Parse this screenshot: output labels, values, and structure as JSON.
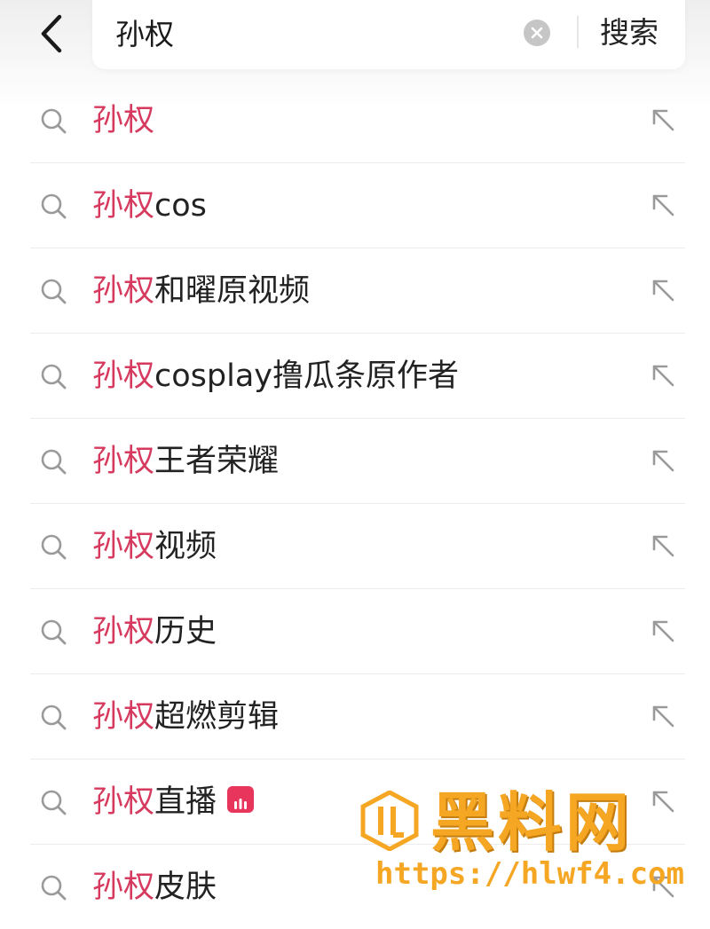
{
  "header": {
    "back_icon": "chevron-left-icon",
    "query": "孙权",
    "clear_icon": "clear-circle-icon",
    "search_label": "搜索"
  },
  "suggestions": [
    {
      "highlight": "孙权",
      "rest": "",
      "badge": null
    },
    {
      "highlight": "孙权",
      "rest": "cos",
      "badge": null
    },
    {
      "highlight": "孙权",
      "rest": "和曜原视频",
      "badge": null
    },
    {
      "highlight": "孙权",
      "rest": "cosplay撸瓜条原作者",
      "badge": null
    },
    {
      "highlight": "孙权",
      "rest": "王者荣耀",
      "badge": null
    },
    {
      "highlight": "孙权",
      "rest": "视频",
      "badge": null
    },
    {
      "highlight": "孙权",
      "rest": "历史",
      "badge": null
    },
    {
      "highlight": "孙权",
      "rest": "超燃剪辑",
      "badge": null
    },
    {
      "highlight": "孙权",
      "rest": "直播",
      "badge": "live-icon"
    },
    {
      "highlight": "孙权",
      "rest": "皮肤",
      "badge": null
    }
  ],
  "colors": {
    "highlight": "#d63a5e",
    "live_badge": "#e8355b",
    "watermark": "#f5a623"
  },
  "watermark": {
    "title": "黑料网",
    "url": "https://hlwf4.com"
  }
}
